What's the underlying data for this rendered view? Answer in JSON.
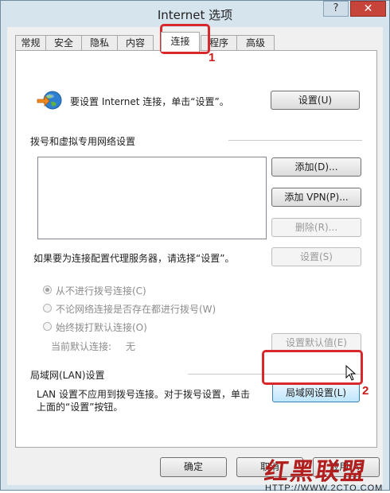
{
  "window": {
    "title": "Internet 选项",
    "help_label": "?",
    "close_label": "✕"
  },
  "tabs": [
    {
      "label": "常规"
    },
    {
      "label": "安全"
    },
    {
      "label": "隐私"
    },
    {
      "label": "内容"
    },
    {
      "label": "连接",
      "active": true
    },
    {
      "label": "程序"
    },
    {
      "label": "高级"
    }
  ],
  "setup": {
    "text": "要设置 Internet 连接，单击“设置”。",
    "button": "设置(U)"
  },
  "dialup": {
    "section_title": "拨号和虚拟专用网络设置",
    "add_button": "添加(D)...",
    "add_vpn_button": "添加 VPN(P)...",
    "delete_button": "删除(R)...",
    "proxy_text": "如果要为连接配置代理服务器，请选择“设置”。",
    "settings_button": "设置(S)",
    "options": [
      {
        "label": "从不进行拨号连接(C)",
        "checked": true
      },
      {
        "label": "不论网络连接是否存在都进行拨号(W)",
        "checked": false
      },
      {
        "label": "始终拨打默认连接(O)",
        "checked": false
      }
    ],
    "current_default_label": "当前默认连接:",
    "current_default_value": "无",
    "set_default_button": "设置默认值(E)"
  },
  "lan": {
    "section_title": "局域网(LAN)设置",
    "text_line1": "LAN 设置不应用到拨号连接。对于拨号设置，单击",
    "text_line2": "上面的“设置”按钮。",
    "button": "局域网设置(L)"
  },
  "footer": {
    "ok": "确定",
    "cancel": "取消",
    "apply": "应用(A)"
  },
  "annotations": {
    "step1": "1",
    "step2": "2",
    "highlight_color": "#d8282c"
  },
  "watermark": {
    "brand": "红黑联盟",
    "url": "HTTP://WWW.2CTO.COM"
  },
  "icons": [
    "globe-connection-icon",
    "mouse-cursor-icon"
  ]
}
